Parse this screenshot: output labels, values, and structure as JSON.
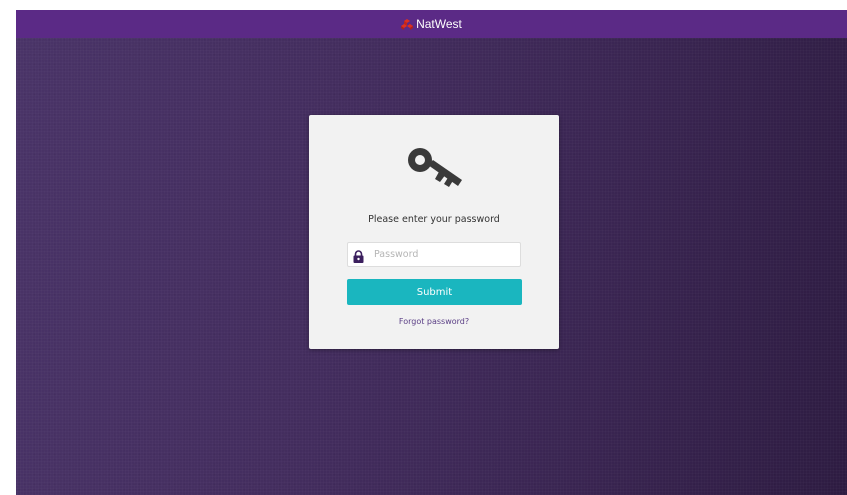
{
  "header": {
    "brand_name": "NatWest",
    "brand_logo_icon": "natwest-cubes-icon",
    "brand_logo_color": "#e0301e",
    "bar_color": "#5b2a86"
  },
  "login": {
    "key_icon": "key-icon",
    "prompt": "Please enter your password",
    "password_field": {
      "icon": "lock-icon",
      "placeholder": "Password",
      "value": ""
    },
    "submit_label": "Submit",
    "submit_color": "#1ab6bf",
    "forgot_link": "Forgot password?"
  }
}
